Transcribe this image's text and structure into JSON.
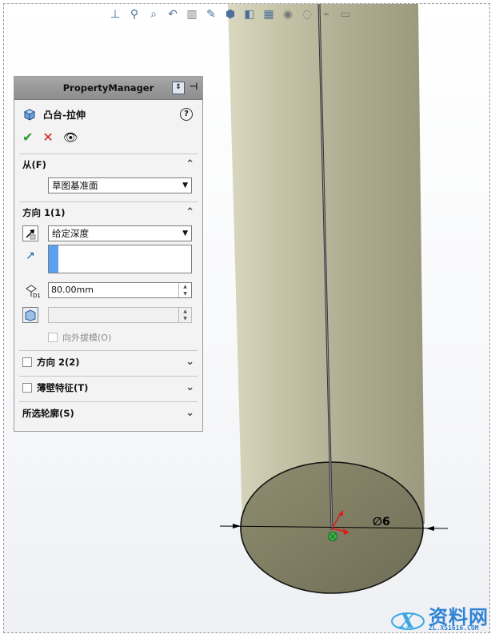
{
  "toolbar": {
    "icons": [
      "view-orientation-icon",
      "zoom-to-fit-icon",
      "zoom-area-icon",
      "previous-view-icon",
      "section-view-icon",
      "dynamic-annotation-icon",
      "view-cube-icon",
      "display-style-icon",
      "hide-show-icon",
      "edit-appearance-icon",
      "apply-scene-icon",
      "view-settings-icon",
      "monitor-icon"
    ]
  },
  "property_manager": {
    "title": "PropertyManager",
    "feature_name": "凸台-拉伸",
    "help_symbol": "?",
    "from_section": {
      "label": "从(F)",
      "selected": "草图基准面"
    },
    "direction1": {
      "label": "方向 1(1)",
      "end_condition": "给定深度",
      "depth": "80.00mm",
      "draft_label": "向外拔模(O)"
    },
    "direction2": {
      "label": "方向 2(2)"
    },
    "thin_feature": {
      "label": "薄壁特征(T)"
    },
    "selected_contours": {
      "label": "所选轮廓(S)"
    }
  },
  "viewport": {
    "dimension_label": "∅6",
    "part_color": "#a7a58a"
  },
  "watermark": {
    "brand": "资料网",
    "url": "ZL.XS1616.COM"
  }
}
